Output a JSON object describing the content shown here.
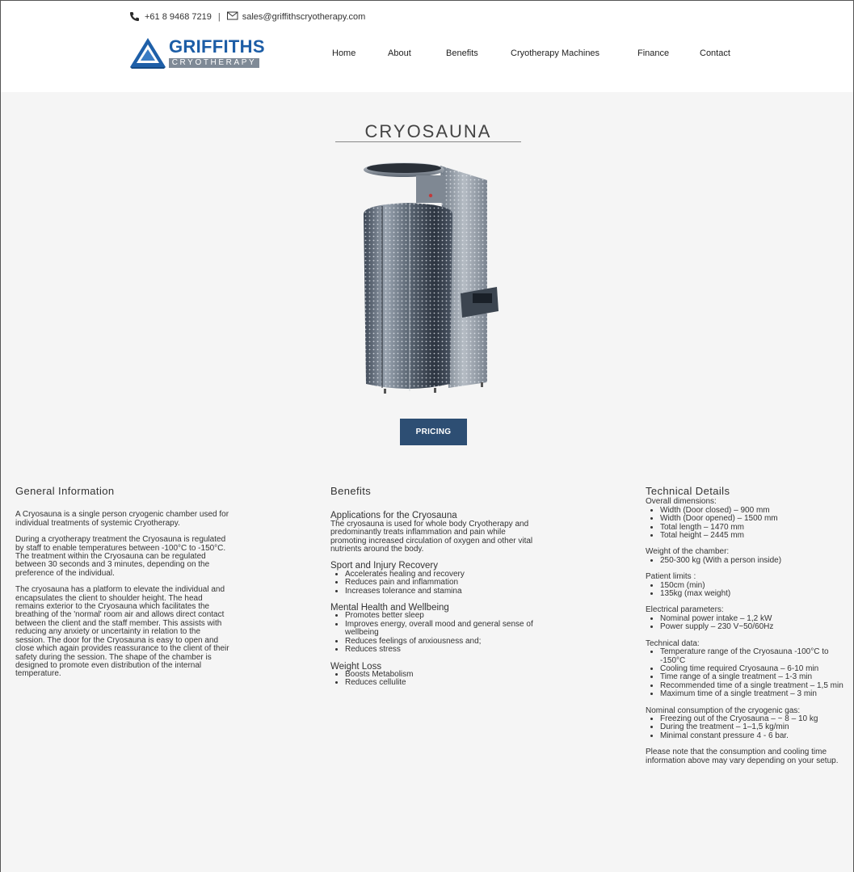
{
  "header": {
    "phone": "+61 8 9468 7219",
    "separator": "|",
    "email": "sales@griffithscryotherapy.com",
    "logo_brand": "GRIFFITHS",
    "logo_sub": "CRYOTHERAPY"
  },
  "nav": {
    "items": [
      "Home",
      "About",
      "Benefits",
      "Cryotherapy Machines",
      "Finance",
      "Contact"
    ]
  },
  "page": {
    "title": "CRYOSAUNA",
    "pricing_label": "PRICING"
  },
  "general": {
    "heading": "General Information",
    "para1": "A Cryosauna is a single person cryogenic chamber used for individual treatments of systemic Cryotherapy.",
    "para2": "During a cryotherapy treatment the Cryosauna is regulated by staff to enable temperatures between -100°C to -150°C. The treatment within the Cryosauna can be regulated between 30 seconds and 3 minutes, depending on the preference of the individual.",
    "para3": "The cryosauna has a platform to elevate the individual and encapsulates the client to shoulder height. The head remains exterior to the Cryosauna which facilitates the breathing of the 'normal' room air and allows direct contact between the client and the staff member. This assists with reducing any anxiety or uncertainty in relation to the session. The door for the Cryosauna is easy to open and close which again provides reassurance to the client of their safety during the session. The shape of the chamber is designed to promote even distribution of the internal temperature."
  },
  "benefits": {
    "heading": "Benefits",
    "apps_title": "Applications for the Cryosauna",
    "apps_text": "The cryosauna is used for whole body Cryotherapy and predominantly treats inflammation and pain while promoting increased circulation of oxygen and other vital nutrients around the body.",
    "sport_title": "Sport and Injury Recovery",
    "sport_items": [
      "Accelerates healing and recovery",
      "Reduces pain and inflammation",
      "Increases tolerance and stamina"
    ],
    "mental_title": "Mental Health and Wellbeing",
    "mental_items": [
      "Promotes better sleep",
      "Improves energy, overall mood and general sense of wellbeing",
      "Reduces feelings of anxiousness and;",
      "Reduces stress"
    ],
    "weight_title": "Weight Loss",
    "weight_items": [
      "Boosts Metabolism",
      "Reduces cellulite"
    ]
  },
  "technical": {
    "heading": "Technical Details",
    "dims_title": "Overall dimensions:",
    "dims_items": [
      "Width (Door closed) – 900 mm",
      "Width (Door opened) – 1500 mm",
      "Total length – 1470 mm",
      "Total height – 2445 mm"
    ],
    "weight_title": "Weight of the chamber:",
    "weight_items": [
      "250-300 kg (With a person inside)"
    ],
    "patient_title": "Patient limits :",
    "patient_items": [
      "150cm (min)",
      "135kg (max weight)"
    ],
    "elec_title": "Electrical parameters:",
    "elec_items": [
      "Nominal power intake – 1,2 kW",
      "Power supply – 230 V~50/60Hz"
    ],
    "data_title": "Technical data:",
    "data_items": [
      "Temperature range of the Cryosauna -100°C to -150°C",
      "Cooling time required Cryosauna – 6-10 min",
      "Time range of a single treatment – 1-3 min",
      "Recommended time of a single treatment – 1,5 min",
      "Maximum time of a single treatment – 3 min"
    ],
    "gas_title": "Nominal consumption of the cryogenic gas:",
    "gas_items": [
      "Freezing out of the Cryosauna – ~ 8 – 10 kg",
      "During the treatment – 1–1,5 kg/min",
      "Minimal constant pressure 4 - 6 bar."
    ],
    "note": "Please note that the consumption and cooling time information above may vary depending on your setup."
  }
}
